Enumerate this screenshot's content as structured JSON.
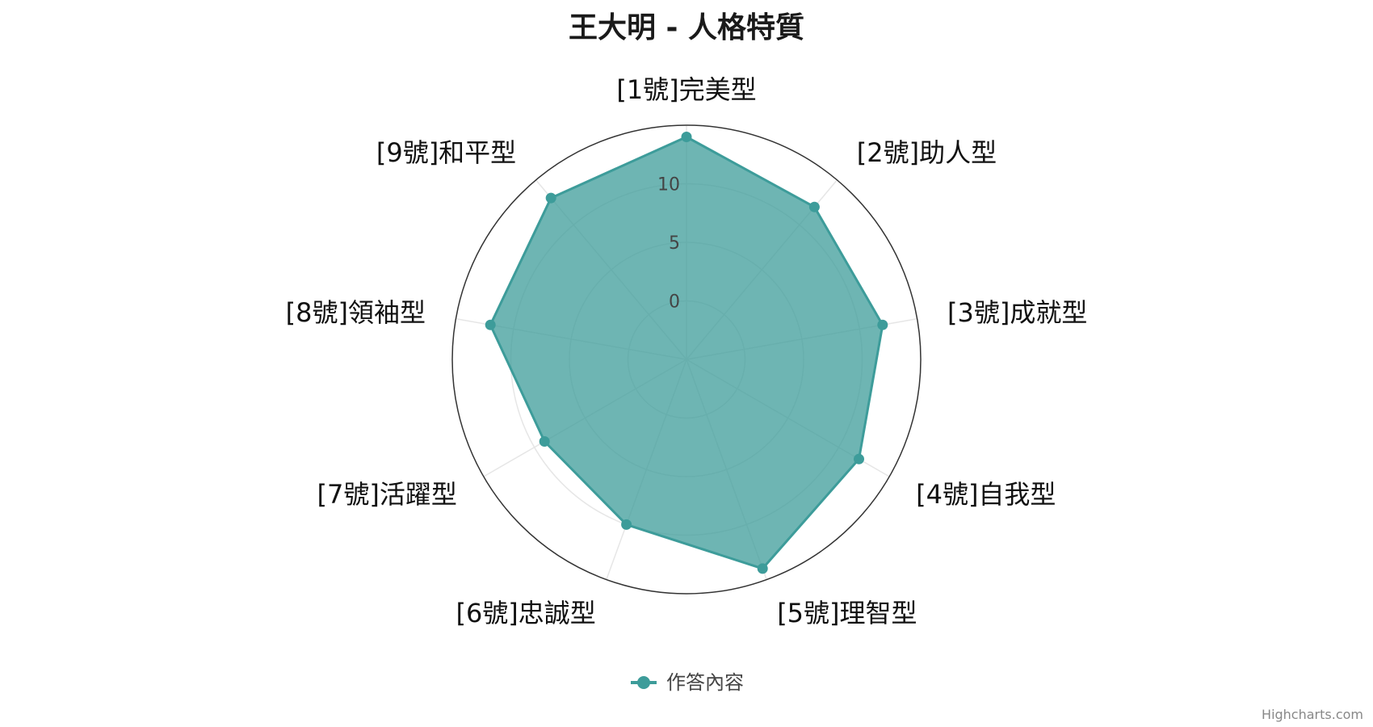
{
  "chart_data": {
    "type": "radar",
    "title": "王大明 - 人格特質",
    "categories": [
      "[1號]完美型",
      "[2號]助人型",
      "[3號]成就型",
      "[4號]自我型",
      "[5號]理智型",
      "[6號]忠誠型",
      "[7號]活躍型",
      "[8號]領袖型",
      "[9號]和平型"
    ],
    "series": [
      {
        "name": "作答內容",
        "values": [
          14,
          12,
          12,
          12,
          14,
          10,
          9,
          12,
          13
        ],
        "color": "#3d9c9a",
        "fill": "#3d9c9a"
      }
    ],
    "yticks": [
      0,
      5,
      10
    ],
    "ylim": [
      -5,
      15
    ],
    "legend_position": "bottom-center",
    "credits": "Highcharts.com"
  }
}
